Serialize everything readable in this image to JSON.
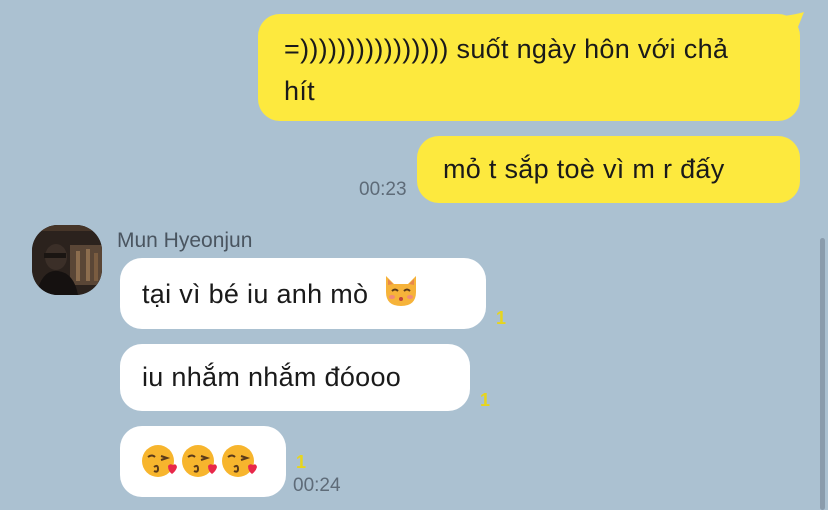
{
  "messages_out": [
    {
      "text_line1": "=)))))))))))))))) suốt ngày hôn với chả",
      "text_line2": "hít"
    },
    {
      "text": "mỏ t sắp toè vì m r đấy",
      "time": "00:23"
    }
  ],
  "contact": {
    "name": "Mun Hyeonjun"
  },
  "messages_in": [
    {
      "text": "tại vì bé iu anh mò",
      "unread": "1"
    },
    {
      "text": "iu nhắm nhắm đóooo",
      "unread": "1"
    },
    {
      "text": "",
      "unread": "1",
      "time": "00:24"
    }
  ],
  "colors": {
    "background": "#abc1d1",
    "outgoing_bubble": "#fde93e",
    "incoming_bubble": "#ffffff",
    "unread_count": "#e7d51d"
  },
  "icons": [
    "kissing-cat-emoji",
    "kissing-face-heart-emoji"
  ]
}
